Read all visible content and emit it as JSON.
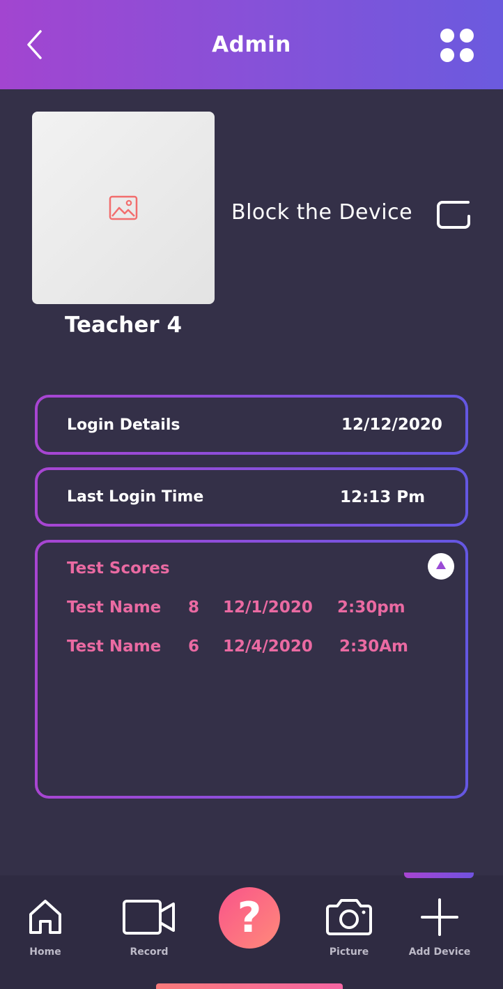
{
  "header": {
    "title": "Admin",
    "back_icon": "chevron-left-icon",
    "menu_icon": "grid-dots-icon"
  },
  "profile": {
    "avatar_icon": "image-placeholder-icon",
    "name": "Teacher 4",
    "block_label": "Block the Device",
    "block_checked": false
  },
  "login_details": {
    "label": "Login Details",
    "value": "12/12/2020"
  },
  "last_login": {
    "label": "Last Login Time",
    "value": "12:13 Pm"
  },
  "test_scores": {
    "title": "Test Scores",
    "expanded": true,
    "rows": [
      {
        "name": "Test Name",
        "score": "8",
        "date": "12/1/2020",
        "time": "2:30pm"
      },
      {
        "name": "Test Name",
        "score": "6",
        "date": "12/4/2020",
        "time": "2:30Am"
      }
    ]
  },
  "bottom_nav": {
    "items": [
      {
        "label": "Home",
        "icon": "home-icon"
      },
      {
        "label": "Record",
        "icon": "video-camera-icon"
      },
      {
        "label": "",
        "icon": "help-icon",
        "glyph": "?"
      },
      {
        "label": "Picture",
        "icon": "camera-icon"
      },
      {
        "label": "Add Device",
        "icon": "plus-icon"
      }
    ],
    "active_index": 4
  },
  "colors": {
    "background": "#343048",
    "header_gradient_start": "#a245d0",
    "header_gradient_end": "#6b5ade",
    "accent_pink": "#ea6aa2",
    "help_gradient_start": "#f9548a",
    "help_gradient_end": "#ff8a7a"
  }
}
